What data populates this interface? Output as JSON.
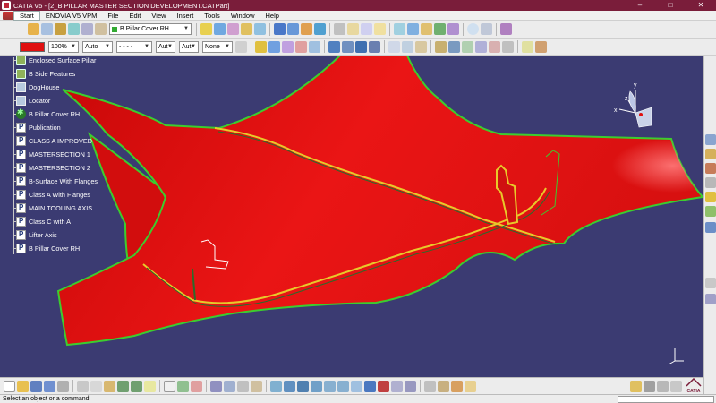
{
  "window": {
    "title": "CATIA V5 - [2_B PILLAR MASTER SECTION DEVELOPMENT.CATPart]",
    "buttons": [
      "–",
      "□",
      "✕"
    ]
  },
  "menu": [
    "Start",
    "ENOVIA V5 VPM",
    "File",
    "Edit",
    "View",
    "Insert",
    "Tools",
    "Window",
    "Help"
  ],
  "toolbar": {
    "current_body": "B Pillar Cover RH",
    "zoom_value": "100%",
    "line_auto": "Auto",
    "line_type": "- - - -",
    "aut1": "Aut",
    "aut2": "Aut",
    "none": "None"
  },
  "colors": {
    "part": "#e41212",
    "edge": "#3ccd2e",
    "section": "#e8c92a",
    "background": "#3b3b72",
    "titlebar": "#7a1d3a"
  },
  "tree": [
    {
      "label": "Enclosed Surface Pillar",
      "icon": "feature-icon"
    },
    {
      "label": "B Side Features",
      "icon": "feature-icon"
    },
    {
      "label": "DogHouse",
      "icon": "geoset-icon"
    },
    {
      "label": "Locator",
      "icon": "geoset-icon"
    },
    {
      "label": "B Pillar Cover RH",
      "icon": "body-icon"
    },
    {
      "label": "Publication",
      "icon": "publication-icon"
    },
    {
      "label": "CLASS A IMPROVED",
      "icon": "publication-icon"
    },
    {
      "label": "MASTERSECTION 1",
      "icon": "publication-icon"
    },
    {
      "label": "MASTERSECTION 2",
      "icon": "publication-icon"
    },
    {
      "label": "B-Surface With Flanges",
      "icon": "publication-icon"
    },
    {
      "label": "Class A With Flanges",
      "icon": "publication-icon"
    },
    {
      "label": "MAIN TOOLING AXIS",
      "icon": "publication-icon"
    },
    {
      "label": "Class C with A",
      "icon": "publication-icon"
    },
    {
      "label": "Lifter Axis",
      "icon": "publication-icon"
    },
    {
      "label": "B Pillar Cover RH",
      "icon": "publication-icon"
    }
  ],
  "compass": {
    "x": "x",
    "y": "y",
    "z": "z"
  },
  "status": {
    "message": "Select an object or a command"
  },
  "logo": {
    "text": "CATIA"
  }
}
